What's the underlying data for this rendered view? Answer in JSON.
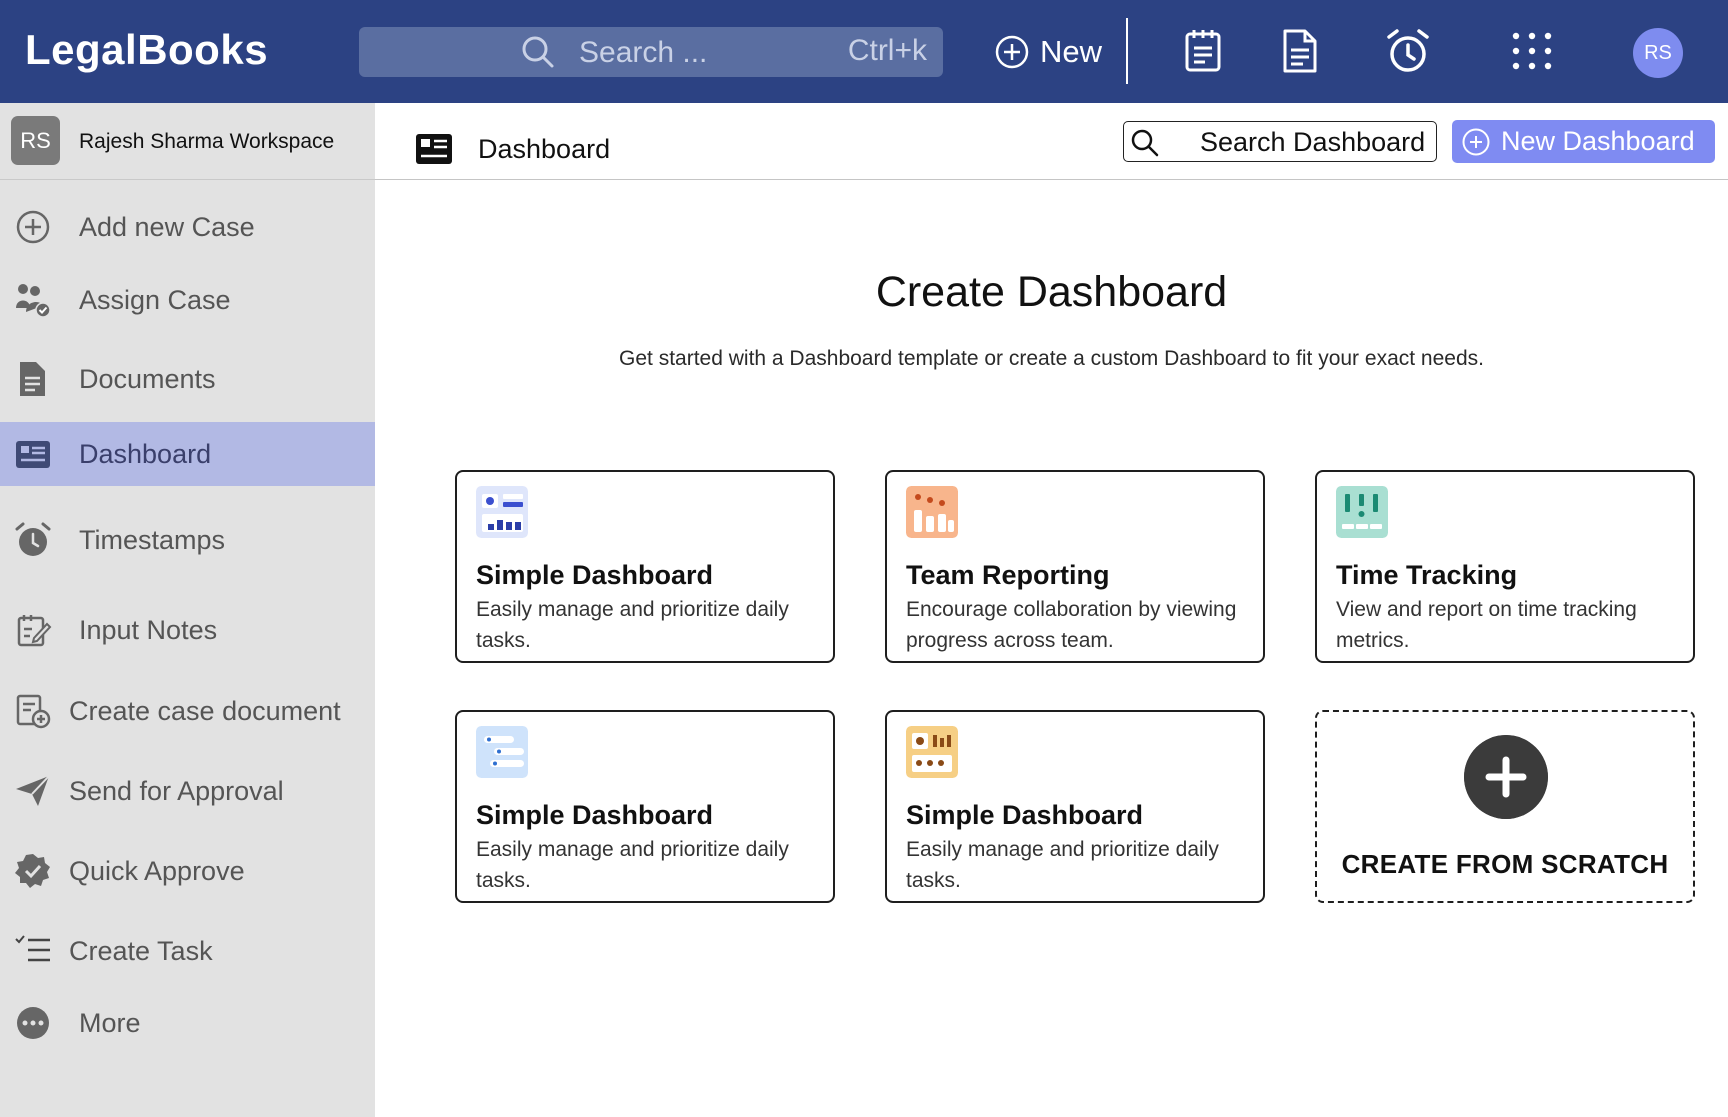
{
  "app": {
    "logo": "LegalBooks",
    "search_placeholder": "Search ...",
    "search_shortcut": "Ctrl+k",
    "new_label": "New",
    "user_initials": "RS",
    "icons": [
      "clipboard-icon",
      "document-icon",
      "alarm-clock-icon",
      "apps-grid-icon"
    ]
  },
  "sidebar": {
    "workspace": {
      "initials": "RS",
      "name": "Rajesh Sharma Workspace"
    },
    "items": [
      {
        "label": "Add new Case",
        "icon": "plus-circle-icon",
        "active": false
      },
      {
        "label": "Assign Case",
        "icon": "assign-users-icon",
        "active": false
      },
      {
        "label": "Documents",
        "icon": "document-icon",
        "active": false
      },
      {
        "label": "Dashboard",
        "icon": "dashboard-icon",
        "active": true
      },
      {
        "label": "Timestamps",
        "icon": "alarm-clock-icon",
        "active": false
      },
      {
        "label": "Input Notes",
        "icon": "edit-note-icon",
        "active": false
      },
      {
        "label": "Create case document",
        "icon": "create-document-icon",
        "active": false
      },
      {
        "label": "Send for Approval",
        "icon": "paper-plane-icon",
        "active": false
      },
      {
        "label": "Quick Approve",
        "icon": "verified-badge-icon",
        "active": false
      },
      {
        "label": "Create Task",
        "icon": "task-list-icon",
        "active": false
      },
      {
        "label": "More",
        "icon": "more-dots-icon",
        "active": false
      }
    ]
  },
  "header": {
    "title": "Dashboard",
    "search_label": "Search Dashboard",
    "new_dashboard_label": "New Dashboard"
  },
  "main": {
    "title": "Create Dashboard",
    "subtitle": "Get started with a Dashboard template or create a custom Dashboard to fit your exact needs.",
    "templates": [
      {
        "title": "Simple Dashboard",
        "description": "Easily manage and prioritize daily tasks.",
        "icon": "simple-dashboard-icon",
        "color": "#dfe6fb"
      },
      {
        "title": "Team Reporting",
        "description": "Encourage collaboration by viewing progress across team.",
        "icon": "team-reporting-icon",
        "color": "#f8b58c"
      },
      {
        "title": "Time Tracking",
        "description": "View and report on time tracking metrics.",
        "icon": "time-tracking-icon",
        "color": "#a9dfd2"
      },
      {
        "title": "Simple Dashboard",
        "description": "Easily manage and prioritize daily tasks.",
        "icon": "list-dashboard-icon",
        "color": "#cfe3fb"
      },
      {
        "title": "Simple Dashboard",
        "description": "Easily manage and prioritize daily tasks.",
        "icon": "grid-dashboard-icon",
        "color": "#f6cf85"
      }
    ],
    "scratch_label": "CREATE FROM SCRATCH"
  },
  "colors": {
    "topbar": "#2c4283",
    "accent": "#7f8bf2",
    "sidebar_bg": "#e2e2e2",
    "sidebar_active": "#b2b9e4"
  }
}
